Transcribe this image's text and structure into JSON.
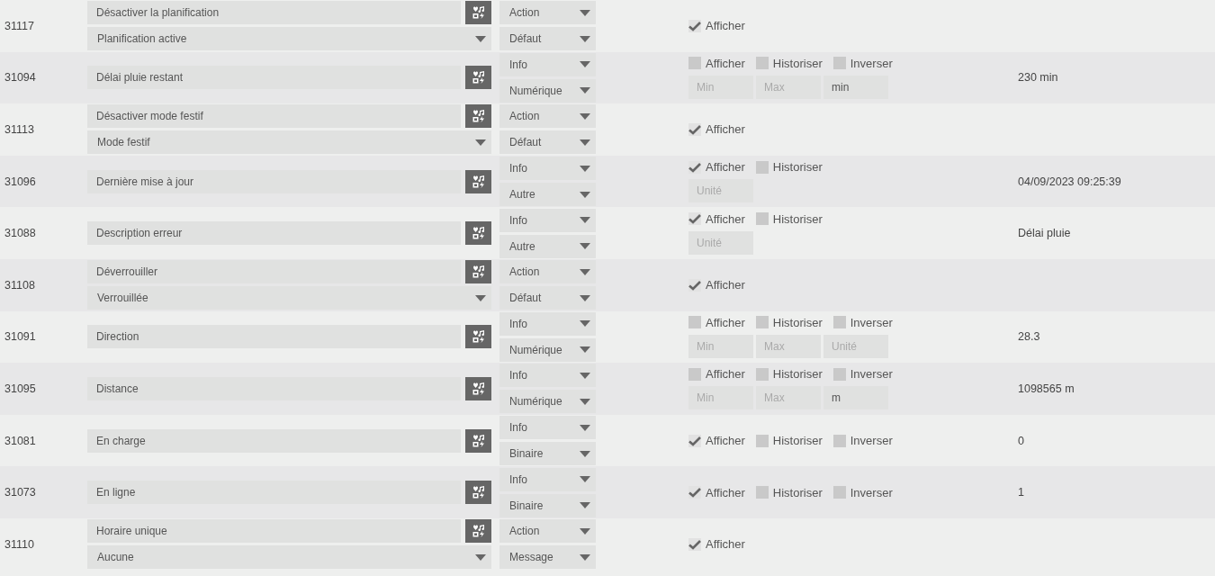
{
  "rows": [
    {
      "id": "31117",
      "kind": "action",
      "name": "Désactiver la planification",
      "state_select": "Planification active",
      "type": "Action",
      "subtype": "Défaut",
      "options": [
        {
          "label": "Afficher",
          "checked": true
        }
      ],
      "fields": [],
      "value": ""
    },
    {
      "id": "31094",
      "kind": "info",
      "name": "Délai pluie restant",
      "type": "Info",
      "subtype": "Numérique",
      "options": [
        {
          "label": "Afficher",
          "checked": false
        },
        {
          "label": "Historiser",
          "checked": false
        },
        {
          "label": "Inverser",
          "checked": false
        }
      ],
      "fields": [
        {
          "placeholder": "Min"
        },
        {
          "placeholder": "Max"
        },
        {
          "value": "min"
        }
      ],
      "value": "230 min"
    },
    {
      "id": "31113",
      "kind": "action",
      "name": "Désactiver mode festif",
      "state_select": "Mode festif",
      "type": "Action",
      "subtype": "Défaut",
      "options": [
        {
          "label": "Afficher",
          "checked": true
        }
      ],
      "fields": [],
      "value": ""
    },
    {
      "id": "31096",
      "kind": "info",
      "name": "Dernière mise à jour",
      "type": "Info",
      "subtype": "Autre",
      "options": [
        {
          "label": "Afficher",
          "checked": true
        },
        {
          "label": "Historiser",
          "checked": false
        }
      ],
      "fields": [
        {
          "placeholder": "Unité"
        }
      ],
      "value": "04/09/2023 09:25:39"
    },
    {
      "id": "31088",
      "kind": "info",
      "name": "Description erreur",
      "type": "Info",
      "subtype": "Autre",
      "options": [
        {
          "label": "Afficher",
          "checked": true
        },
        {
          "label": "Historiser",
          "checked": false
        }
      ],
      "fields": [
        {
          "placeholder": "Unité"
        }
      ],
      "value": "Délai pluie"
    },
    {
      "id": "31108",
      "kind": "action",
      "name": "Déverrouiller",
      "state_select": "Verrouillée",
      "type": "Action",
      "subtype": "Défaut",
      "options": [
        {
          "label": "Afficher",
          "checked": true
        }
      ],
      "fields": [],
      "value": ""
    },
    {
      "id": "31091",
      "kind": "info",
      "name": "Direction",
      "type": "Info",
      "subtype": "Numérique",
      "options": [
        {
          "label": "Afficher",
          "checked": false
        },
        {
          "label": "Historiser",
          "checked": false
        },
        {
          "label": "Inverser",
          "checked": false
        }
      ],
      "fields": [
        {
          "placeholder": "Min"
        },
        {
          "placeholder": "Max"
        },
        {
          "placeholder": "Unité"
        }
      ],
      "value": "28.3"
    },
    {
      "id": "31095",
      "kind": "info",
      "name": "Distance",
      "type": "Info",
      "subtype": "Numérique",
      "options": [
        {
          "label": "Afficher",
          "checked": false
        },
        {
          "label": "Historiser",
          "checked": false
        },
        {
          "label": "Inverser",
          "checked": false
        }
      ],
      "fields": [
        {
          "placeholder": "Min"
        },
        {
          "placeholder": "Max"
        },
        {
          "value": "m"
        }
      ],
      "value": "1098565 m"
    },
    {
      "id": "31081",
      "kind": "info",
      "name": "En charge",
      "type": "Info",
      "subtype": "Binaire",
      "options": [
        {
          "label": "Afficher",
          "checked": true
        },
        {
          "label": "Historiser",
          "checked": false
        },
        {
          "label": "Inverser",
          "checked": false
        }
      ],
      "fields": [],
      "value": "0"
    },
    {
      "id": "31073",
      "kind": "info",
      "name": "En ligne",
      "type": "Info",
      "subtype": "Binaire",
      "options": [
        {
          "label": "Afficher",
          "checked": true
        },
        {
          "label": "Historiser",
          "checked": false
        },
        {
          "label": "Inverser",
          "checked": false
        }
      ],
      "fields": [],
      "value": "1"
    },
    {
      "id": "31110",
      "kind": "action",
      "name": "Horaire unique",
      "state_select": "Aucune",
      "type": "Action",
      "subtype": "Message",
      "options": [
        {
          "label": "Afficher",
          "checked": true
        }
      ],
      "fields": [],
      "value": ""
    }
  ]
}
